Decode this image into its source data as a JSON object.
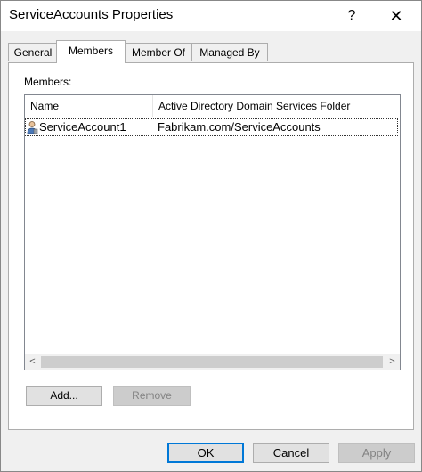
{
  "window": {
    "title": "ServiceAccounts Properties",
    "help_label": "?",
    "close_label": "✕"
  },
  "tabs": [
    {
      "label": "General"
    },
    {
      "label": "Members"
    },
    {
      "label": "Member Of"
    },
    {
      "label": "Managed By"
    }
  ],
  "active_tab": "Members",
  "members": {
    "label": "Members:",
    "columns": [
      {
        "label": "Name"
      },
      {
        "label": "Active Directory Domain Services Folder"
      }
    ],
    "rows": [
      {
        "name": "ServiceAccount1",
        "folder": "Fabrikam.com/ServiceAccounts",
        "icon": "user-icon"
      }
    ],
    "scroll_left_label": "<",
    "scroll_right_label": ">",
    "add_label": "Add...",
    "remove_label": "Remove"
  },
  "footer": {
    "ok_label": "OK",
    "cancel_label": "Cancel",
    "apply_label": "Apply"
  },
  "colors": {
    "default_button_border": "#0078d7",
    "dialog_bg": "#f0f0f0",
    "panel_bg": "#ffffff"
  }
}
